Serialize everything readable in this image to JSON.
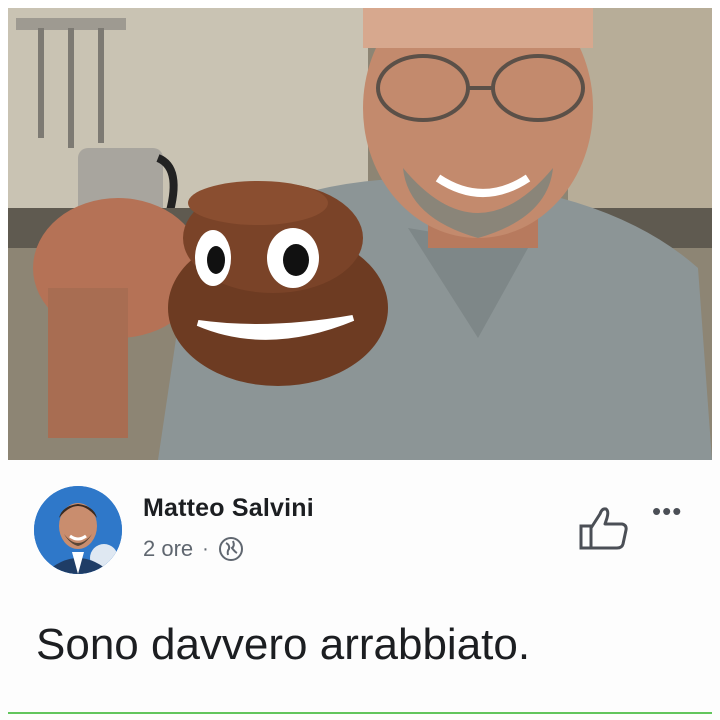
{
  "photo": {
    "description_icon": "photo-mug-icon"
  },
  "post": {
    "author_name": "Matteo Salvini",
    "time_ago": "2 ore",
    "separator": "·",
    "privacy_icon": "globe-icon",
    "like_icon": "thumbs-up-icon",
    "more_icon": "more-dots-icon",
    "more_glyph": "•••",
    "text": "Sono davvero arrabbiato."
  },
  "colors": {
    "text_primary": "#1c1e21",
    "text_secondary": "#606770",
    "divider_green": "#62c65d",
    "avatar_blue": "#2f78c9"
  }
}
